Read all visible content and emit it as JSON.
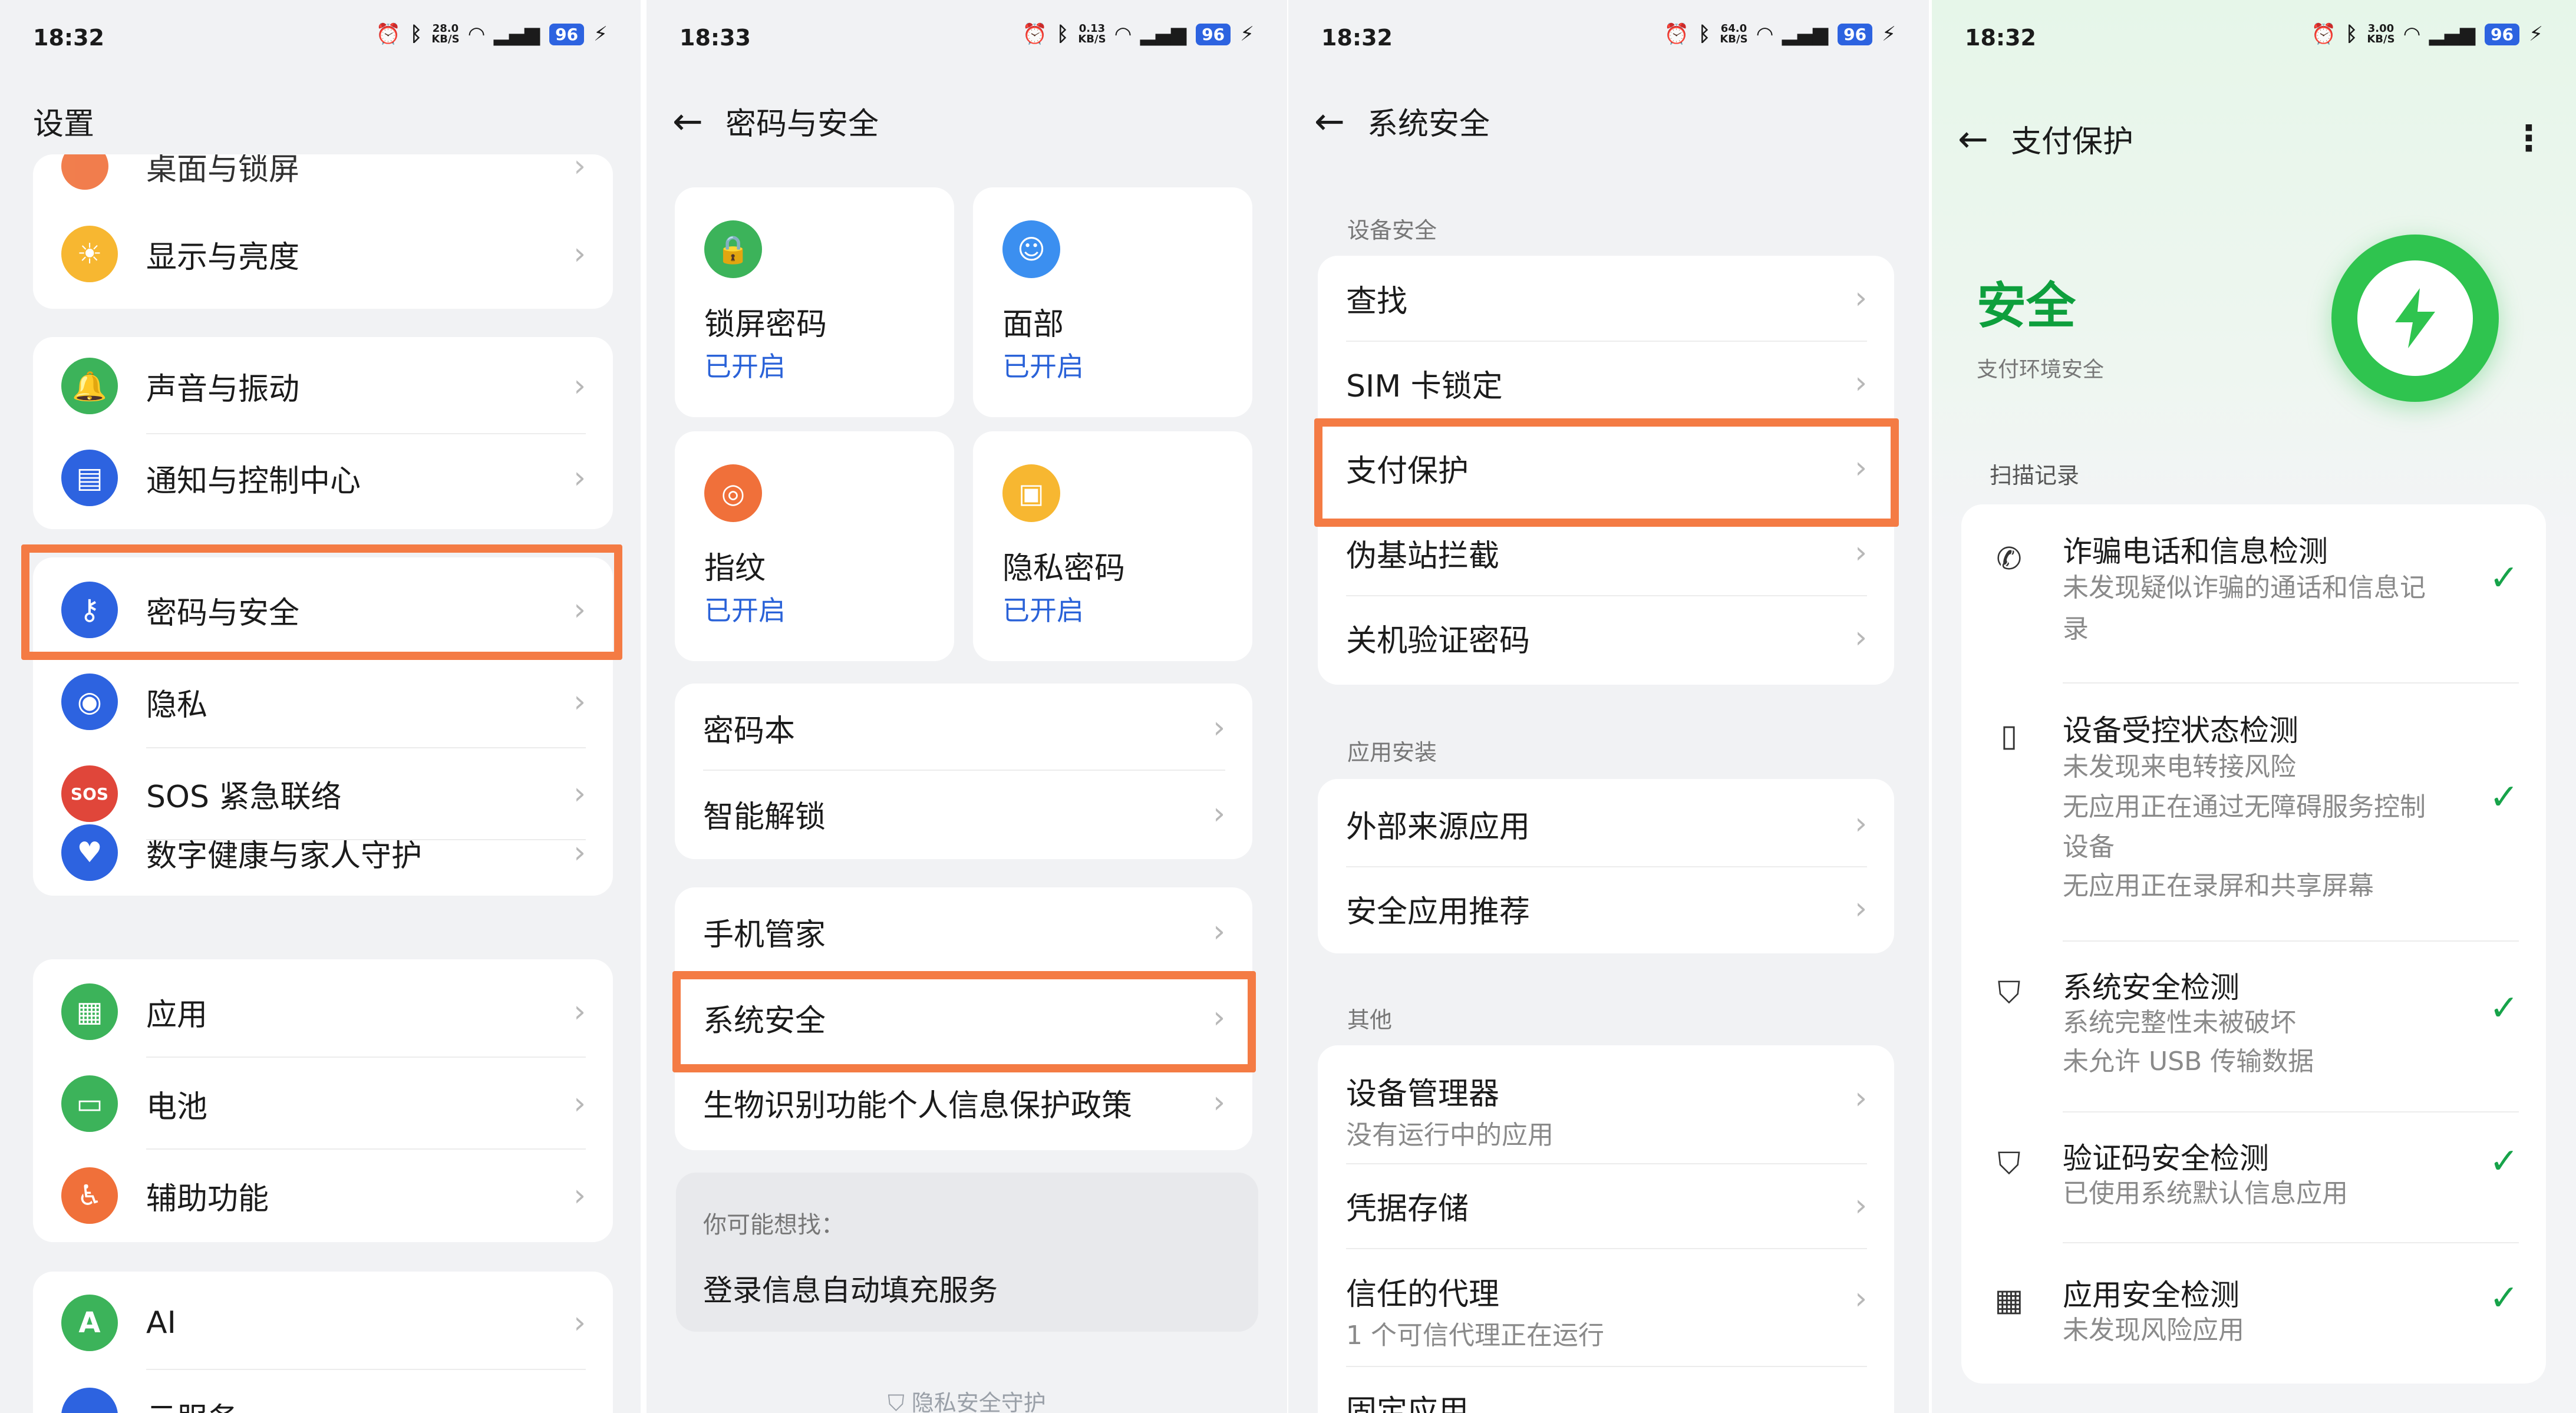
{
  "status": [
    {
      "time": "18:32",
      "net": "28.0",
      "net_unit": "KB/S",
      "battery": "96"
    },
    {
      "time": "18:33",
      "net": "0.13",
      "net_unit": "KB/S",
      "battery": "96"
    },
    {
      "time": "18:32",
      "net": "64.0",
      "net_unit": "KB/S",
      "battery": "96"
    },
    {
      "time": "18:32",
      "net": "3.00",
      "net_unit": "KB/S",
      "battery": "96"
    }
  ],
  "settings": {
    "title": "设置",
    "partial_top": "桌面与锁屏",
    "groups": [
      [
        "显示与亮度"
      ],
      [
        "声音与振动",
        "通知与控制中心"
      ],
      [
        "密码与安全",
        "隐私",
        "SOS 紧急联络",
        "数字健康与家人守护"
      ],
      [
        "应用",
        "电池",
        "辅助功能"
      ],
      [
        "AI",
        "云服务"
      ]
    ],
    "sos_badge": "SOS"
  },
  "password_security": {
    "title": "密码与安全",
    "tiles": [
      {
        "label": "锁屏密码",
        "status": "已开启"
      },
      {
        "label": "面部",
        "status": "已开启"
      },
      {
        "label": "指纹",
        "status": "已开启"
      },
      {
        "label": "隐私密码",
        "status": "已开启"
      }
    ],
    "group1": [
      "密码本",
      "智能解锁"
    ],
    "group2": [
      "手机管家",
      "系统安全",
      "生物识别功能个人信息保护政策"
    ],
    "suggest_q": "你可能想找：",
    "suggest_a": "登录信息自动填充服务",
    "footer": "隐私安全守护"
  },
  "system_security": {
    "title": "系统安全",
    "section1": "设备安全",
    "items1": [
      "查找",
      "SIM 卡锁定",
      "支付保护",
      "伪基站拦截",
      "关机验证密码"
    ],
    "section2": "应用安装",
    "items2": [
      "外部来源应用",
      "安全应用推荐"
    ],
    "section3": "其他",
    "items3": [
      {
        "label": "设备管理器",
        "sub": "没有运行中的应用"
      },
      {
        "label": "凭据存储",
        "sub": ""
      },
      {
        "label": "信任的代理",
        "sub": "1 个可信代理正在运行"
      },
      {
        "label": "固定应用",
        "sub": ""
      }
    ]
  },
  "payment": {
    "title": "支付保护",
    "status": "安全",
    "status_sub": "支付环境安全",
    "scan_label": "扫描记录",
    "items": [
      {
        "icon": "phone-icon",
        "title": "诈骗电话和信息检测",
        "desc": [
          "未发现疑似诈骗的通话和信息记",
          "录"
        ]
      },
      {
        "icon": "device-icon",
        "title": "设备受控状态检测",
        "desc": [
          "未发现来电转接风险",
          "无应用正在通过无障碍服务控制",
          "设备",
          "无应用正在录屏和共享屏幕"
        ]
      },
      {
        "icon": "shield-icon",
        "title": "系统安全检测",
        "desc": [
          "系统完整性未被破坏",
          "未允许 USB 传输数据"
        ]
      },
      {
        "icon": "shield-check-icon",
        "title": "验证码安全检测",
        "desc": [
          "已使用系统默认信息应用"
        ]
      },
      {
        "icon": "apps-icon",
        "title": "应用安全检测",
        "desc": [
          "未发现风险应用"
        ]
      }
    ]
  },
  "colors": {
    "highlight": "#f47b44",
    "accent_blue": "#2a62d8",
    "safe_green": "#0e9f3d"
  }
}
